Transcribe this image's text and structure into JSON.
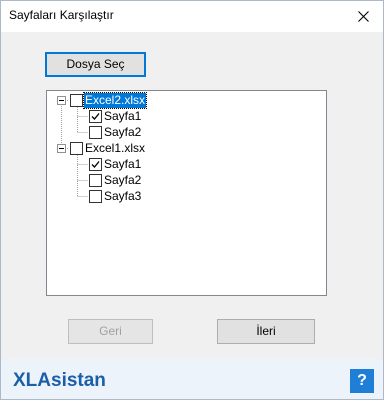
{
  "window": {
    "title": "Sayfaları Karşılaştır",
    "close_symbol": "✕"
  },
  "buttons": {
    "select_file": "Dosya Seç",
    "back": "Geri",
    "next": "İleri"
  },
  "tree": [
    {
      "label": "Excel2.xlsx",
      "checked": false,
      "expanded": true,
      "selected": true,
      "children": [
        {
          "label": "Sayfa1",
          "checked": true
        },
        {
          "label": "Sayfa2",
          "checked": false
        }
      ]
    },
    {
      "label": "Excel1.xlsx",
      "checked": false,
      "expanded": true,
      "selected": false,
      "children": [
        {
          "label": "Sayfa1",
          "checked": true
        },
        {
          "label": "Sayfa2",
          "checked": false
        },
        {
          "label": "Sayfa3",
          "checked": false
        }
      ]
    }
  ],
  "footer": {
    "brand": "XLAsistan",
    "help_label": "?"
  },
  "colors": {
    "accent": "#0078d7",
    "brand": "#1a5fa8",
    "footer_bg": "#ecf3fb"
  }
}
